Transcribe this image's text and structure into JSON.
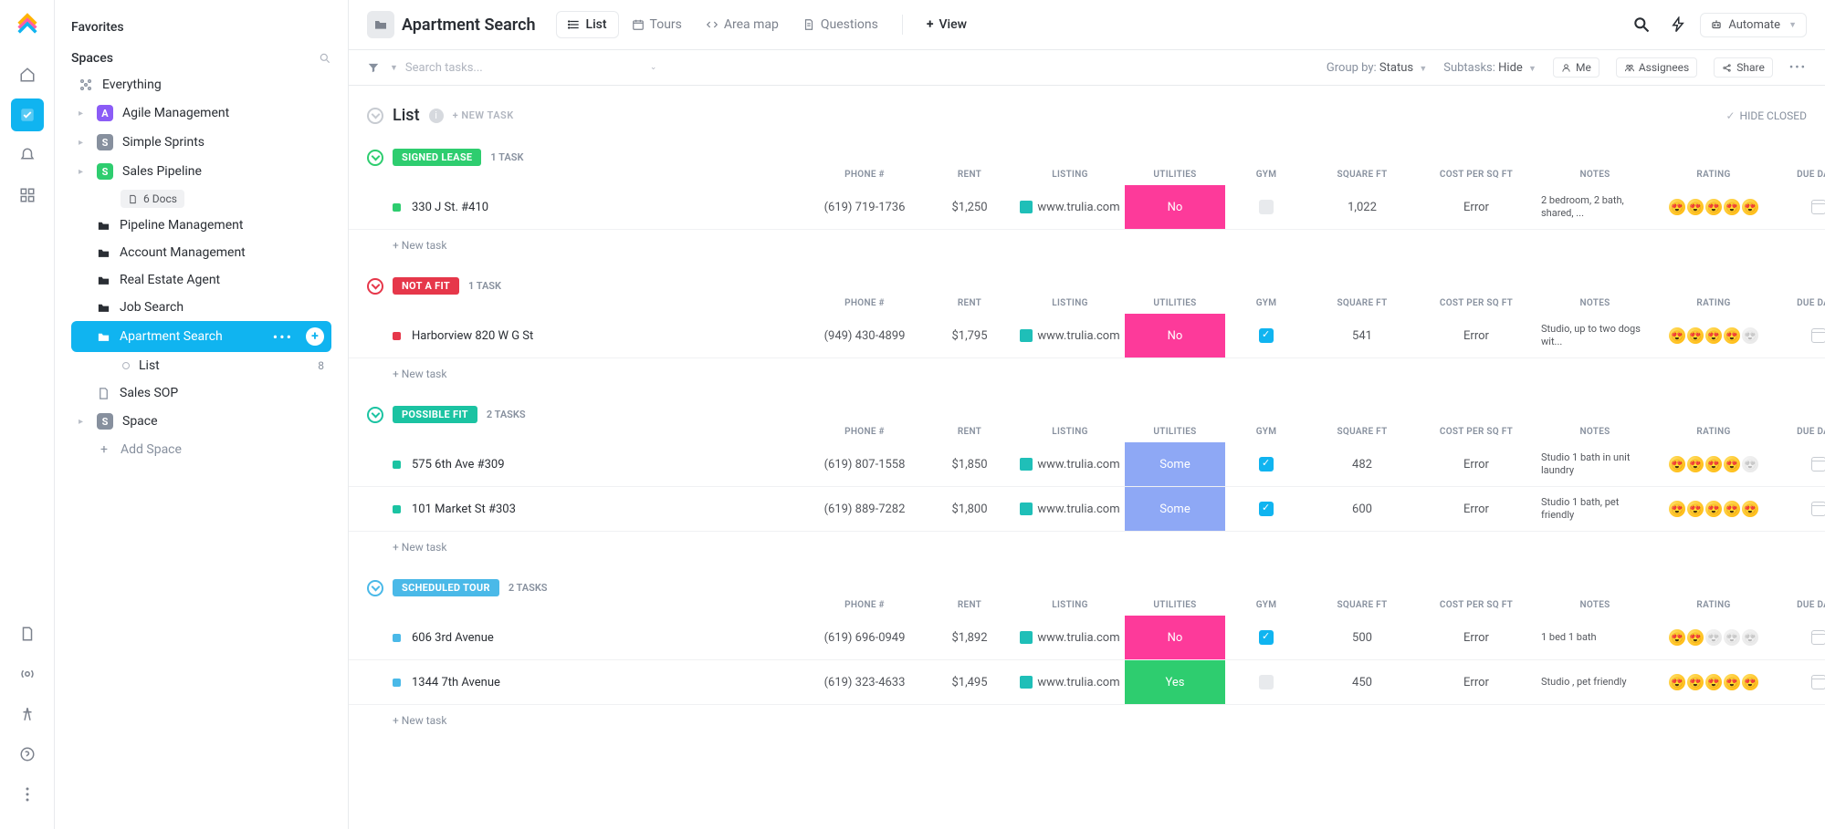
{
  "sidebar": {
    "favorites": "Favorites",
    "spaces": "Spaces",
    "everything": "Everything",
    "items": [
      {
        "label": "Agile Management",
        "color": "purple",
        "letter": "A"
      },
      {
        "label": "Simple Sprints",
        "color": "gray",
        "letter": "S"
      },
      {
        "label": "Sales Pipeline",
        "color": "green",
        "letter": "S"
      }
    ],
    "docs_label": "6 Docs",
    "folders": [
      "Pipeline Management",
      "Account Management",
      "Real Estate Agent",
      "Job Search"
    ],
    "active_folder": "Apartment Search",
    "list_item": "List",
    "list_count": "8",
    "sales_sop": "Sales SOP",
    "space_item": "Space",
    "add_space": "Add Space"
  },
  "header": {
    "title": "Apartment Search",
    "tabs": [
      {
        "label": "List",
        "active": true,
        "icon": "list"
      },
      {
        "label": "Tours",
        "icon": "cal"
      },
      {
        "label": "Area map",
        "icon": "code"
      },
      {
        "label": "Questions",
        "icon": "doc"
      }
    ],
    "add_view": "View",
    "automate": "Automate"
  },
  "filter": {
    "search_placeholder": "Search tasks...",
    "group_by": "Group by:",
    "group_val": "Status",
    "subtasks": "Subtasks:",
    "subtasks_val": "Hide",
    "me": "Me",
    "assignees": "Assignees",
    "share": "Share"
  },
  "list": {
    "title": "List",
    "new_task": "+ NEW TASK",
    "hide_closed": "HIDE CLOSED",
    "add_task": "+ New task"
  },
  "columns": [
    "",
    "PHONE #",
    "RENT",
    "LISTING",
    "UTILITIES",
    "GYM",
    "SQUARE FT",
    "COST PER SQ FT",
    "NOTES",
    "RATING",
    "DUE DATE"
  ],
  "groups": [
    {
      "name": "SIGNED LEASE",
      "count": "1 TASK",
      "color": "#2ecd6f",
      "rows": [
        {
          "dot": "#2ecd6f",
          "name": "330 J St. #410",
          "phone": "(619) 719-1736",
          "rent": "$1,250",
          "listing": "www.trulia.com",
          "util": "No",
          "util_color": "#fd3a9a",
          "gym": false,
          "sqft": "1,022",
          "cost": "Error",
          "notes": "2 bedroom, 2 bath, shared, ...",
          "rating": 5
        }
      ]
    },
    {
      "name": "NOT A FIT",
      "count": "1 TASK",
      "color": "#e6374a",
      "rows": [
        {
          "dot": "#e6374a",
          "name": "Harborview 820 W G St",
          "phone": "(949) 430-4899",
          "rent": "$1,795",
          "listing": "www.trulia.com",
          "util": "No",
          "util_color": "#fd3a9a",
          "gym": true,
          "sqft": "541",
          "cost": "Error",
          "notes": "Studio, up to two dogs wit...",
          "rating": 4
        }
      ]
    },
    {
      "name": "POSSIBLE FIT",
      "count": "2 TASKS",
      "color": "#1bc3a2",
      "rows": [
        {
          "dot": "#1bc3a2",
          "name": "575 6th Ave #309",
          "phone": "(619) 807-1558",
          "rent": "$1,850",
          "listing": "www.trulia.com",
          "util": "Some",
          "util_color": "#8ea8f5",
          "gym": true,
          "sqft": "482",
          "cost": "Error",
          "notes": "Studio 1 bath in unit laundry",
          "rating": 4
        },
        {
          "dot": "#1bc3a2",
          "name": "101 Market St #303",
          "phone": "(619) 889-7282",
          "rent": "$1,800",
          "listing": "www.trulia.com",
          "util": "Some",
          "util_color": "#8ea8f5",
          "gym": true,
          "sqft": "600",
          "cost": "Error",
          "notes": "Studio 1 bath, pet friendly",
          "rating": 5
        }
      ]
    },
    {
      "name": "SCHEDULED TOUR",
      "count": "2 TASKS",
      "color": "#4ab9e8",
      "rows": [
        {
          "dot": "#4ab9e8",
          "name": "606 3rd Avenue",
          "phone": "(619) 696-0949",
          "rent": "$1,892",
          "listing": "www.trulia.com",
          "util": "No",
          "util_color": "#fd3a9a",
          "gym": true,
          "sqft": "500",
          "cost": "Error",
          "notes": "1 bed 1 bath",
          "rating": 2
        },
        {
          "dot": "#4ab9e8",
          "name": "1344 7th Avenue",
          "phone": "(619) 323-4633",
          "rent": "$1,495",
          "listing": "www.trulia.com",
          "util": "Yes",
          "util_color": "#2ecd6f",
          "gym": false,
          "sqft": "450",
          "cost": "Error",
          "notes": "Studio\n, pet friendly",
          "rating": 5
        }
      ]
    }
  ]
}
